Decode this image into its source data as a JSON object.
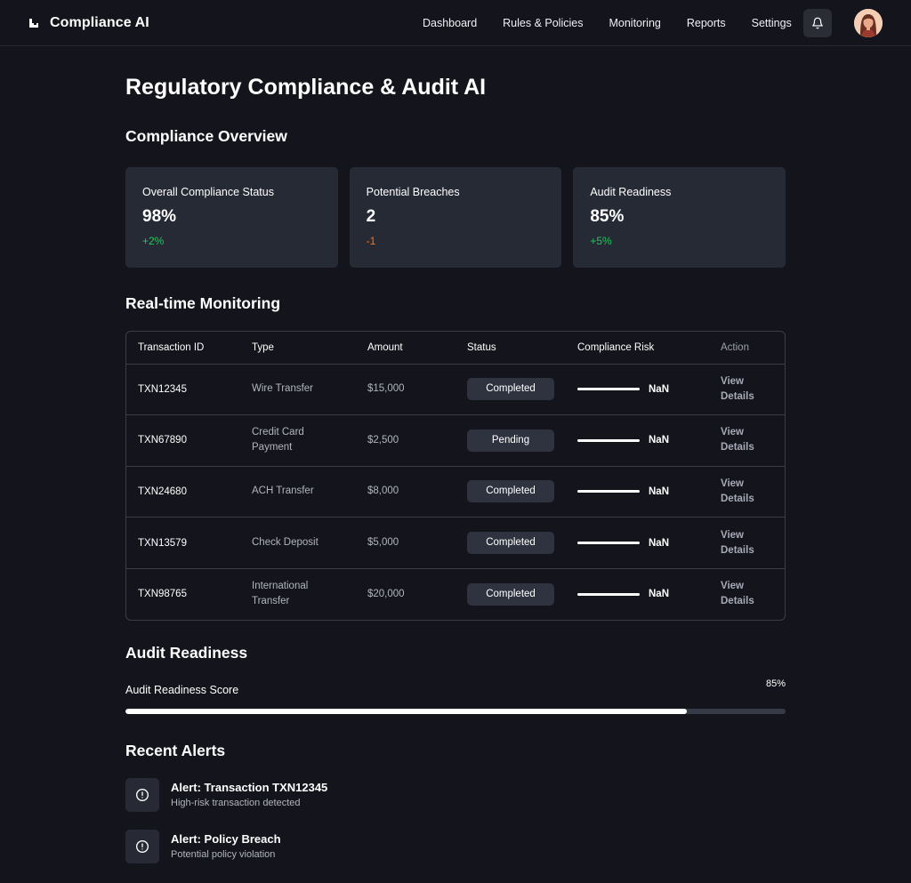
{
  "header": {
    "brand": "Compliance AI",
    "nav": [
      "Dashboard",
      "Rules & Policies",
      "Monitoring",
      "Reports",
      "Settings"
    ]
  },
  "page_title": "Regulatory Compliance & Audit AI",
  "overview": {
    "title": "Compliance Overview",
    "cards": [
      {
        "label": "Overall Compliance Status",
        "value": "98%",
        "delta": "+2%",
        "trend": "up"
      },
      {
        "label": "Potential Breaches",
        "value": "2",
        "delta": "-1",
        "trend": "down"
      },
      {
        "label": "Audit Readiness",
        "value": "85%",
        "delta": "+5%",
        "trend": "up"
      }
    ]
  },
  "monitoring": {
    "title": "Real-time Monitoring",
    "columns": [
      "Transaction ID",
      "Type",
      "Amount",
      "Status",
      "Compliance Risk",
      "Action"
    ],
    "rows": [
      {
        "id": "TXN12345",
        "type": "Wire Transfer",
        "amount": "$15,000",
        "status": "Completed",
        "risk": "NaN",
        "action": "View Details"
      },
      {
        "id": "TXN67890",
        "type": "Credit Card Payment",
        "amount": "$2,500",
        "status": "Pending",
        "risk": "NaN",
        "action": "View Details"
      },
      {
        "id": "TXN24680",
        "type": "ACH Transfer",
        "amount": "$8,000",
        "status": "Completed",
        "risk": "NaN",
        "action": "View Details"
      },
      {
        "id": "TXN13579",
        "type": "Check Deposit",
        "amount": "$5,000",
        "status": "Completed",
        "risk": "NaN",
        "action": "View Details"
      },
      {
        "id": "TXN98765",
        "type": "International Transfer",
        "amount": "$20,000",
        "status": "Completed",
        "risk": "NaN",
        "action": "View Details"
      }
    ]
  },
  "audit": {
    "title": "Audit Readiness",
    "score_label": "Audit Readiness Score",
    "score_text": "85%",
    "score_fraction": 0.85
  },
  "alerts": {
    "title": "Recent Alerts",
    "items": [
      {
        "title": "Alert: Transaction TXN12345",
        "desc": "High-risk transaction detected"
      },
      {
        "title": "Alert: Policy Breach",
        "desc": "Potential policy violation"
      }
    ]
  },
  "colors": {
    "background": "#14151c",
    "card": "#262a35",
    "positive": "#22c55e",
    "negative": "#f97316"
  },
  "icons": [
    "logo-icon",
    "bell-icon",
    "alert-circle-icon"
  ]
}
